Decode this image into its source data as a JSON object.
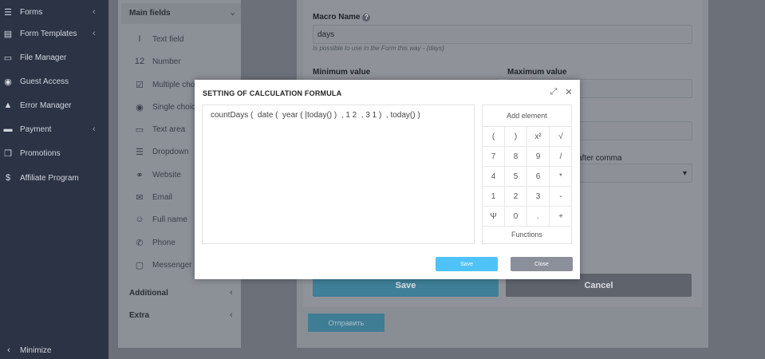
{
  "sidebar": {
    "items": [
      {
        "icon": "forms-icon",
        "glyph": "☰",
        "label": "Forms",
        "chevron": true
      },
      {
        "icon": "form-templates-icon",
        "glyph": "▤",
        "label": "Form Templates",
        "chevron": true
      },
      {
        "icon": "file-manager-icon",
        "glyph": "▭",
        "label": "File Manager",
        "chevron": false
      },
      {
        "icon": "guest-access-icon",
        "glyph": "◉",
        "label": "Guest Access",
        "chevron": false
      },
      {
        "icon": "error-manager-icon",
        "glyph": "▲",
        "label": "Error Manager",
        "chevron": false
      },
      {
        "icon": "payment-icon",
        "glyph": "▬",
        "label": "Payment",
        "chevron": true
      },
      {
        "icon": "promotions-icon",
        "glyph": "❒",
        "label": "Promotions",
        "chevron": false
      },
      {
        "icon": "affiliate-program-icon",
        "glyph": "$",
        "label": "Affiliate Program",
        "chevron": false
      }
    ],
    "minimize_label": "Minimize",
    "chevron_glyph": "‹"
  },
  "fields_panel": {
    "main_title": "Main fields",
    "chevron_down": "⌄",
    "items": [
      {
        "icon": "text-field-icon",
        "glyph": "I",
        "label": "Text field"
      },
      {
        "icon": "number-icon",
        "glyph": "12",
        "label": "Number"
      },
      {
        "icon": "multiple-choice-icon",
        "glyph": "☑",
        "label": "Multiple choi"
      },
      {
        "icon": "single-choice-icon",
        "glyph": "◉",
        "label": "Single choice"
      },
      {
        "icon": "text-area-icon",
        "glyph": "▭",
        "label": "Text area"
      },
      {
        "icon": "dropdown-icon",
        "glyph": "☰",
        "label": "Dropdown"
      },
      {
        "icon": "website-icon",
        "glyph": "⚭",
        "label": "Website"
      },
      {
        "icon": "email-icon",
        "glyph": "✉",
        "label": "Email"
      },
      {
        "icon": "full-name-icon",
        "glyph": "☺",
        "label": "Full name"
      },
      {
        "icon": "phone-icon",
        "glyph": "✆",
        "label": "Phone"
      },
      {
        "icon": "messenger-icon",
        "glyph": "▢",
        "label": "Messenger"
      }
    ],
    "additional_label": "Additional",
    "extra_label": "Extra"
  },
  "macro": {
    "name_label": "Macro Name",
    "help_glyph": "?",
    "name_value": "days",
    "hint": "Is possible to use in the Form this way - {days}",
    "min_label": "Minimum value",
    "max_label": "Maximum value",
    "after_comma_label": "after comma",
    "select_arrow": "▾",
    "save_label": "Save",
    "cancel_label": "Cancel",
    "send_label": "Отправить"
  },
  "modal": {
    "title": "SETTING OF CALCULATION FORMULA",
    "expand_glyph": "⤢",
    "close_glyph": "✕",
    "formula": "countDays (  date (  year ( |today() )  , 1 2  , 3 1 )  , today() )",
    "pad_title": "Add element",
    "keys": [
      "(",
      ")",
      "x²",
      "√",
      "7",
      "8",
      "9",
      "/",
      "4",
      "5",
      "6",
      "*",
      "1",
      "2",
      "3",
      "-",
      "Ψ",
      "0",
      ".",
      "+"
    ],
    "functions_label": "Functions",
    "save_label": "Save",
    "close_label": "Close"
  },
  "colors": {
    "sidebar_bg": "#2b3345",
    "save_blue": "#4fc3f7",
    "close_gray": "#8a8f99"
  }
}
